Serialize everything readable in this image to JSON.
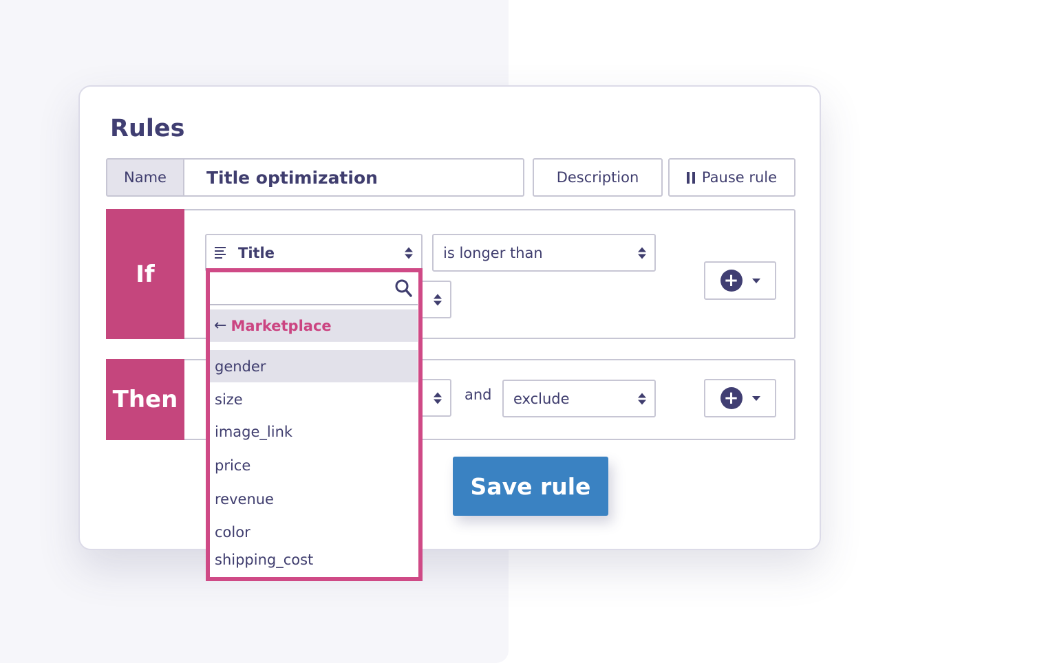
{
  "title": "Rules",
  "name_row": {
    "label": "Name",
    "value": "Title optimization",
    "description_label": "Description",
    "pause_label": "Pause rule"
  },
  "if_block": {
    "label": "If",
    "field": "Title",
    "operator": "is longer than"
  },
  "then_block": {
    "label": "Then",
    "and_label": "and",
    "action": "exclude"
  },
  "dropdown": {
    "search_placeholder": "",
    "back_label": "Marketplace",
    "options": [
      "gender",
      "size",
      "image_link",
      "price",
      "revenue",
      "color",
      "shipping_cost"
    ],
    "highlighted": "gender"
  },
  "save_label": "Save rule",
  "colors": {
    "accent_pink": "#c5467d",
    "save_blue": "#3a82c2",
    "text_navy": "#3f3d6e"
  },
  "icons": {
    "add": "plus-circle-icon",
    "pause": "pause-icon",
    "search": "search-icon",
    "field_type": "text-lines-icon"
  }
}
